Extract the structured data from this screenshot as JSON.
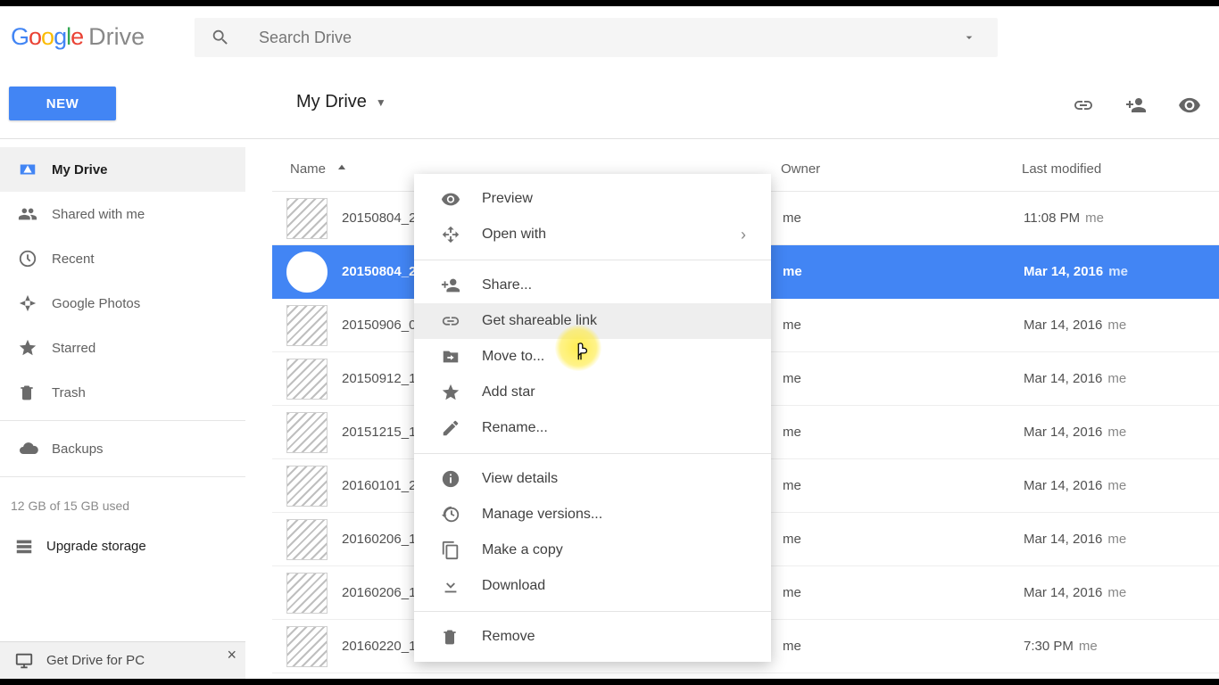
{
  "logo": {
    "product": "Drive"
  },
  "search": {
    "placeholder": "Search Drive"
  },
  "new_button": "NEW",
  "location": "My Drive",
  "sidebar": {
    "items": [
      {
        "label": "My Drive",
        "icon": "drive"
      },
      {
        "label": "Shared with me",
        "icon": "people"
      },
      {
        "label": "Recent",
        "icon": "clock"
      },
      {
        "label": "Google Photos",
        "icon": "photos"
      },
      {
        "label": "Starred",
        "icon": "star"
      },
      {
        "label": "Trash",
        "icon": "trash"
      }
    ],
    "backups": "Backups",
    "quota": "12 GB of 15 GB used",
    "upgrade": "Upgrade storage",
    "promo": "Get Drive for PC"
  },
  "columns": {
    "name": "Name",
    "owner": "Owner",
    "modified": "Last modified"
  },
  "files": [
    {
      "name": "20150804_2",
      "owner": "me",
      "modified": "11:08 PM",
      "by": "me"
    },
    {
      "name": "20150804_2",
      "owner": "me",
      "modified": "Mar 14, 2016",
      "by": "me"
    },
    {
      "name": "20150906_0",
      "owner": "me",
      "modified": "Mar 14, 2016",
      "by": "me"
    },
    {
      "name": "20150912_1",
      "owner": "me",
      "modified": "Mar 14, 2016",
      "by": "me"
    },
    {
      "name": "20151215_1",
      "owner": "me",
      "modified": "Mar 14, 2016",
      "by": "me"
    },
    {
      "name": "20160101_2",
      "owner": "me",
      "modified": "Mar 14, 2016",
      "by": "me"
    },
    {
      "name": "20160206_1",
      "owner": "me",
      "modified": "Mar 14, 2016",
      "by": "me"
    },
    {
      "name": "20160206_1",
      "owner": "me",
      "modified": "Mar 14, 2016",
      "by": "me"
    },
    {
      "name": "20160220_1",
      "owner": "me",
      "modified": "7:30 PM",
      "by": "me"
    }
  ],
  "context_menu": {
    "items": [
      {
        "label": "Preview",
        "icon": "eye"
      },
      {
        "label": "Open with",
        "icon": "openwith",
        "submenu": true
      },
      {
        "sep": true
      },
      {
        "label": "Share...",
        "icon": "personadd"
      },
      {
        "label": "Get shareable link",
        "icon": "link",
        "hover": true
      },
      {
        "label": "Move to...",
        "icon": "moveto"
      },
      {
        "label": "Add star",
        "icon": "star"
      },
      {
        "label": "Rename...",
        "icon": "rename"
      },
      {
        "sep": true
      },
      {
        "label": "View details",
        "icon": "info"
      },
      {
        "label": "Manage versions...",
        "icon": "history"
      },
      {
        "label": "Make a copy",
        "icon": "copy"
      },
      {
        "label": "Download",
        "icon": "download"
      },
      {
        "sep": true
      },
      {
        "label": "Remove",
        "icon": "trash"
      }
    ]
  }
}
